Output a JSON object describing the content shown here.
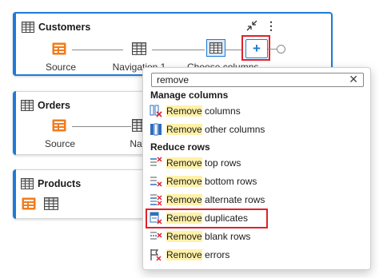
{
  "cards": {
    "customers": {
      "title": "Customers",
      "steps": [
        "Source",
        "Navigation 1",
        "Choose columns"
      ]
    },
    "orders": {
      "title": "Orders",
      "steps": [
        "Source",
        "Naviga"
      ]
    },
    "products": {
      "title": "Products"
    }
  },
  "menu": {
    "search_value": "remove",
    "sections": [
      {
        "header": "Manage columns",
        "items": [
          {
            "highlight": "Remove",
            "rest": " columns",
            "icon": "remove-columns-icon"
          },
          {
            "highlight": "Remove",
            "rest": " other columns",
            "icon": "remove-other-columns-icon"
          }
        ]
      },
      {
        "header": "Reduce rows",
        "items": [
          {
            "highlight": "Remove",
            "rest": " top rows",
            "icon": "remove-top-rows-icon"
          },
          {
            "highlight": "Remove",
            "rest": " bottom rows",
            "icon": "remove-bottom-rows-icon"
          },
          {
            "highlight": "Remove",
            "rest": " alternate rows",
            "icon": "remove-alternate-rows-icon"
          },
          {
            "highlight": "Remove",
            "rest": " duplicates",
            "icon": "remove-duplicates-icon"
          },
          {
            "highlight": "Remove",
            "rest": " blank rows",
            "icon": "remove-blank-rows-icon"
          },
          {
            "highlight": "Remove",
            "rest": " errors",
            "icon": "remove-errors-icon"
          }
        ]
      }
    ]
  },
  "colors": {
    "accent": "#1e7bd6",
    "callout": "#e0212b",
    "source_icon": "#f07c1c",
    "search_highlight": "#fff1a8"
  }
}
